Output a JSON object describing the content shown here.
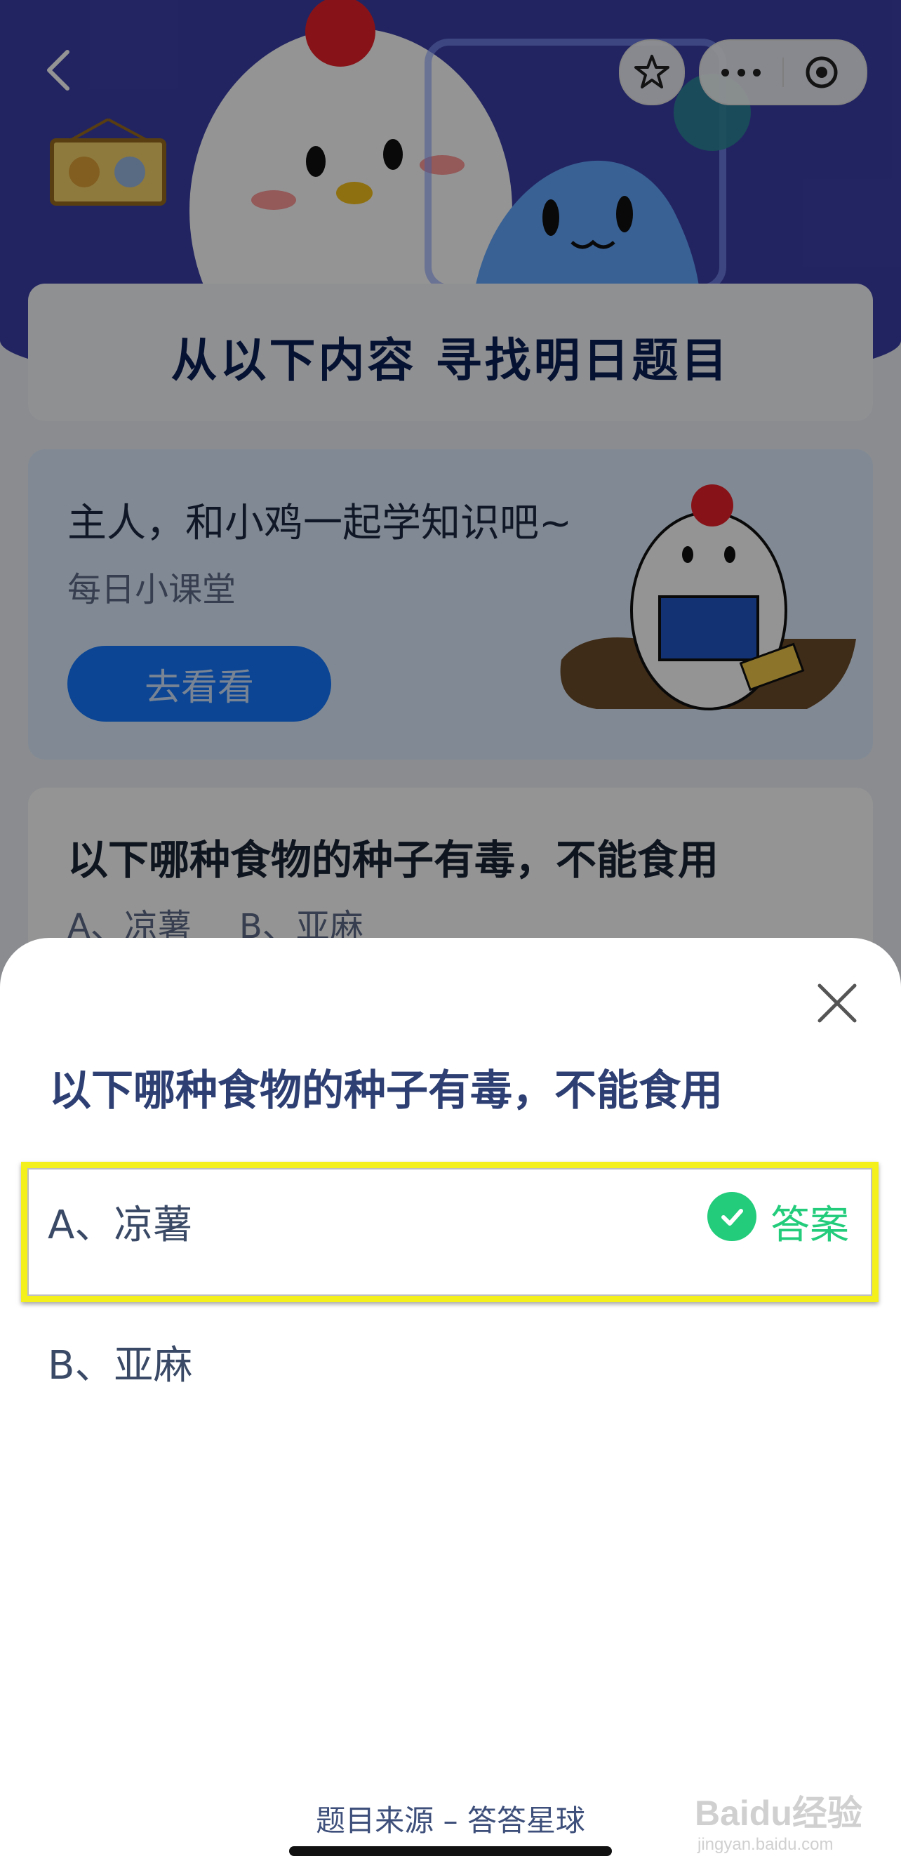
{
  "background": {
    "header_title": "从以下内容  寻找明日题目",
    "lesson_card": {
      "title": "主人，和小鸡一起学知识吧~",
      "subtitle": "每日小课堂",
      "button_label": "去看看"
    },
    "quiz_card": {
      "question": "以下哪种食物的种子有毒，不能食用",
      "options": [
        "A、凉薯",
        "B、亚麻"
      ]
    }
  },
  "sheet": {
    "question": "以下哪种食物的种子有毒，不能食用",
    "options": [
      {
        "label": "A、凉薯",
        "is_answer": true,
        "answer_tag": "答案"
      },
      {
        "label": "B、亚麻",
        "is_answer": false
      }
    ],
    "source": "题目来源 – 答答星球"
  },
  "watermark": {
    "line1": "Baidu经验",
    "line2": "jingyan.baidu.com"
  },
  "colors": {
    "accent_green": "#22cc7b",
    "highlight_yellow": "#f3f01c",
    "question_blue": "#2d3f73",
    "button_blue": "#1477ff"
  },
  "icons": [
    "back-icon",
    "star-favorite-icon",
    "more-dots-icon",
    "target-icon",
    "close-icon",
    "check-circle-icon"
  ]
}
